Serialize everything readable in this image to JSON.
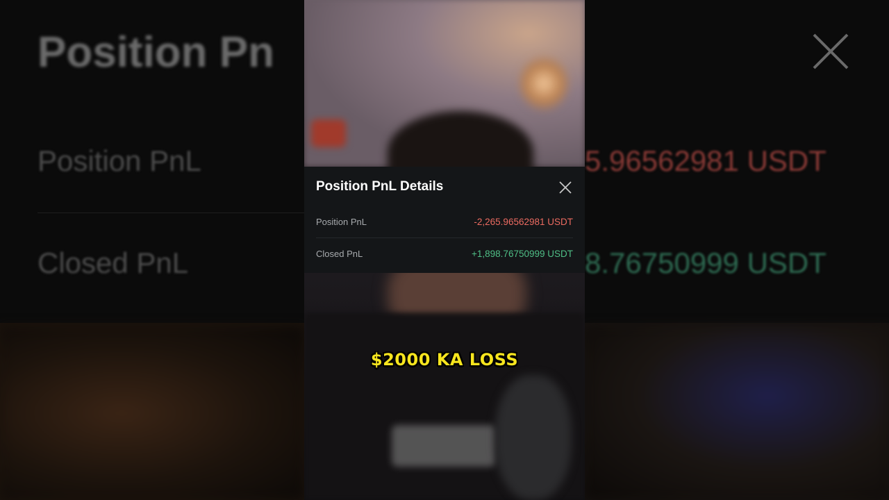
{
  "background": {
    "title": "Position Pn",
    "row1_label": "Position PnL",
    "row2_label": "Closed PnL",
    "row1_value": "5.96562981 USDT",
    "row2_value": "8.76750999 USDT",
    "close_icon": "close-icon"
  },
  "modal": {
    "title": "Position PnL Details",
    "close_icon": "close-icon",
    "rows": [
      {
        "label": "Position PnL",
        "value": "-2,265.96562981 USDT"
      },
      {
        "label": "Closed PnL",
        "value": "+1,898.76750999 USDT"
      }
    ]
  },
  "caption": "$2000 KA LOSS",
  "colors": {
    "negative": "#ec6b61",
    "positive": "#4fbf86",
    "caption": "#f7e51e"
  }
}
